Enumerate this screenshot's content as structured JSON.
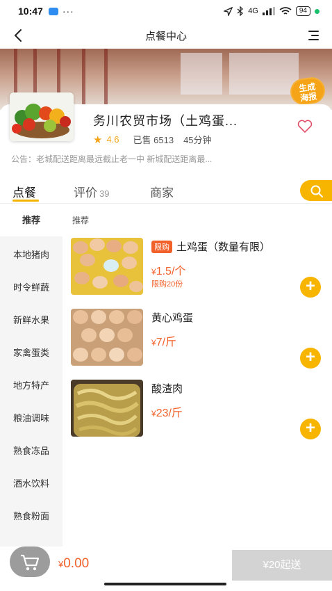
{
  "status_bar": {
    "time": "10:47",
    "more": "···",
    "network": "4G",
    "battery": "94"
  },
  "nav": {
    "title": "点餐中心"
  },
  "promo_badge": {
    "line1": "生成",
    "line2": "海报"
  },
  "store": {
    "name": "务川农贸市场（土鸡蛋...",
    "rating": "4.6",
    "sold": "已售 6513",
    "delivery_time": "45分钟",
    "notice": "公告：老城配送距离最远截止老一中 新城配送距离最..."
  },
  "tabs": [
    {
      "label": "点餐",
      "count": ""
    },
    {
      "label": "评价",
      "count": "39"
    },
    {
      "label": "商家",
      "count": ""
    }
  ],
  "sidebar": {
    "items": [
      "推荐",
      "本地猪肉",
      "时令鲜蔬",
      "新鲜水果",
      "家禽蛋类",
      "地方特产",
      "粮油调味",
      "熟食冻品",
      "酒水饮料",
      "熟食粉面"
    ]
  },
  "section_title": "推荐",
  "products": [
    {
      "tag": "限购",
      "name": "土鸡蛋（数量有限）",
      "currency": "¥",
      "price": "1.5",
      "unit": "/个",
      "limit_note": "限购20份"
    },
    {
      "tag": "",
      "name": "黄心鸡蛋",
      "currency": "¥",
      "price": "7",
      "unit": "/斤",
      "limit_note": ""
    },
    {
      "tag": "",
      "name": "酸渣肉",
      "currency": "¥",
      "price": "23",
      "unit": "/斤",
      "limit_note": ""
    }
  ],
  "cart": {
    "currency": "¥",
    "total": "0.00",
    "checkout_label": "¥20起送"
  },
  "colors": {
    "accent": "#f7b500",
    "price": "#f2612a",
    "disabled": "#d3d3d3"
  }
}
